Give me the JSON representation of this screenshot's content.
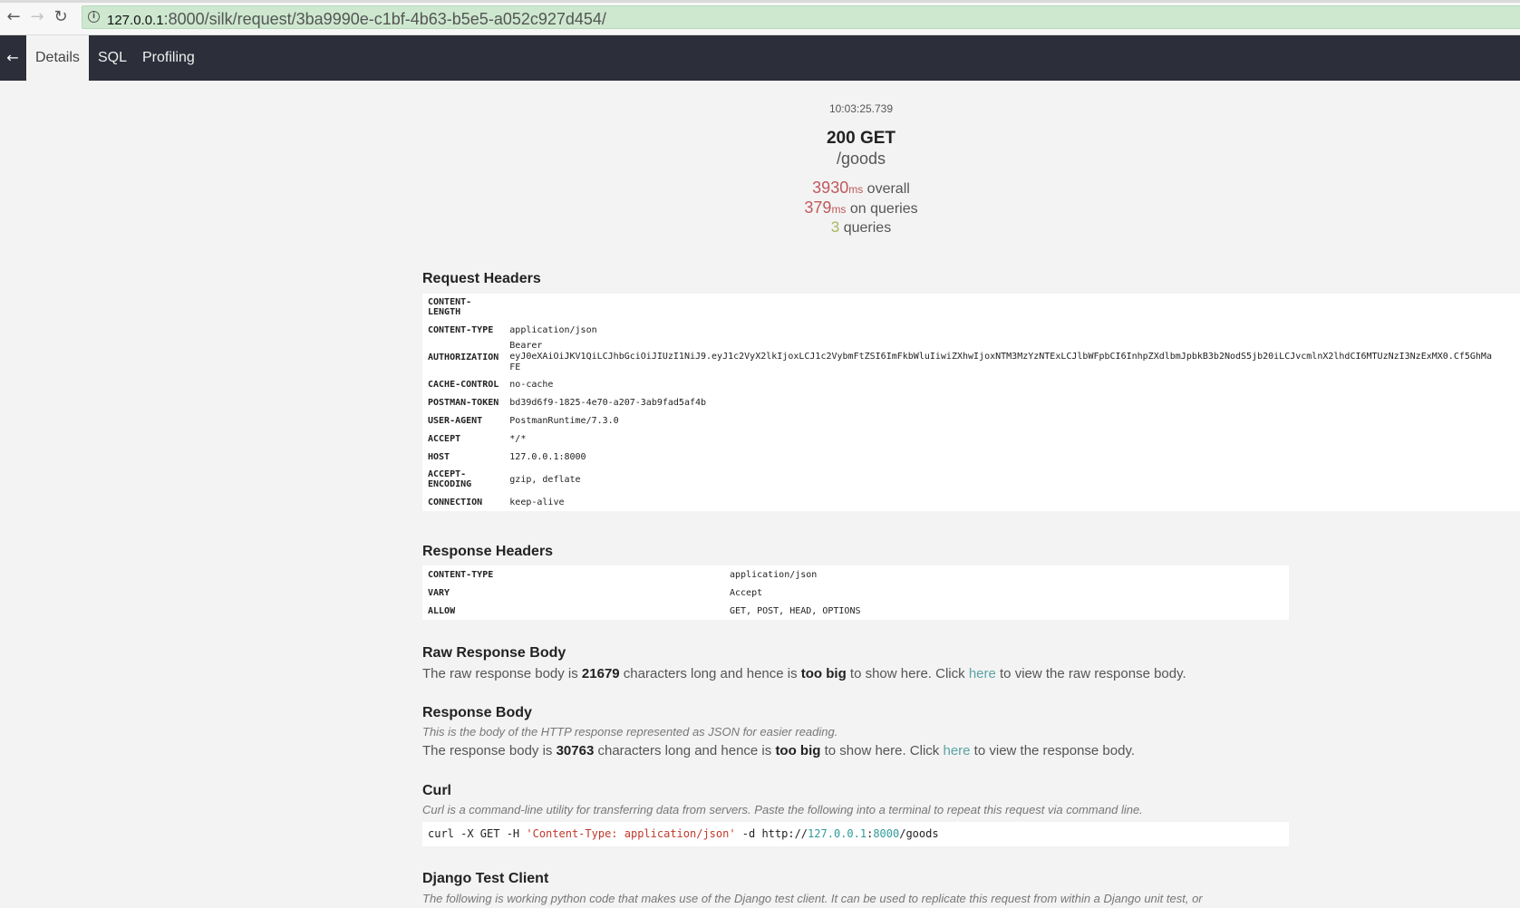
{
  "browser": {
    "url_host": "127.0.0.1",
    "url_rest": ":8000/silk/request/3ba9990e-c1bf-4b63-b5e5-a052c927d454/"
  },
  "nav": {
    "tabs": [
      {
        "label": "Details",
        "active": true
      },
      {
        "label": "SQL",
        "active": false
      },
      {
        "label": "Profiling",
        "active": false
      }
    ]
  },
  "summary": {
    "timestamp": "10:03:25.739",
    "status_line": "200 GET",
    "path": "/goods",
    "overall_value": "3930",
    "overall_unit": "ms",
    "overall_label": "overall",
    "queries_time_value": "379",
    "queries_time_unit": "ms",
    "queries_time_label": "on queries",
    "query_count": "3",
    "query_count_label": "queries"
  },
  "request_headers": {
    "title": "Request Headers",
    "rows": [
      {
        "key": "CONTENT-\nLENGTH",
        "value": ""
      },
      {
        "key": "CONTENT-TYPE",
        "value": "application/json"
      },
      {
        "key": "AUTHORIZATION",
        "value": "Bearer\neyJ0eXAiOiJKV1QiLCJhbGciOiJIUzI1NiJ9.eyJ1c2VyX2lkIjoxLCJ1c2VybmFtZSI6ImFkbWluIiwiZXhwIjoxNTM3MzYzNTExLCJlbWFpbCI6InhpZXdlbmJpbkB3b2NodS5jb20iLCJvcmlnX2lhdCI6MTUzNzI3NzExMX0.Cf5GhMa\nFE"
      },
      {
        "key": "CACHE-CONTROL",
        "value": "no-cache"
      },
      {
        "key": "POSTMAN-TOKEN",
        "value": "bd39d6f9-1825-4e70-a207-3ab9fad5af4b"
      },
      {
        "key": "USER-AGENT",
        "value": "PostmanRuntime/7.3.0"
      },
      {
        "key": "ACCEPT",
        "value": "*/*"
      },
      {
        "key": "HOST",
        "value": "127.0.0.1:8000"
      },
      {
        "key": "ACCEPT-\nENCODING",
        "value": "gzip, deflate"
      },
      {
        "key": "CONNECTION",
        "value": "keep-alive"
      }
    ]
  },
  "response_headers": {
    "title": "Response Headers",
    "rows": [
      {
        "key": "CONTENT-TYPE",
        "value": "application/json"
      },
      {
        "key": "VARY",
        "value": "Accept"
      },
      {
        "key": "ALLOW",
        "value": "GET, POST, HEAD, OPTIONS"
      }
    ]
  },
  "raw_body": {
    "title": "Raw Response Body",
    "text_1": "The raw response body is ",
    "length": "21679",
    "text_2": " characters long and hence is ",
    "too_big": "too big",
    "text_3": " to show here. Click ",
    "link": "here",
    "text_4": " to view the raw response body."
  },
  "body": {
    "title": "Response Body",
    "desc": "This is the body of the HTTP response represented as JSON for easier reading.",
    "text_1": "The response body is ",
    "length": "30763",
    "text_2": " characters long and hence is ",
    "too_big": "too big",
    "text_3": " to show here. Click ",
    "link": "here",
    "text_4": " to view the response body."
  },
  "curl": {
    "title": "Curl",
    "desc": "Curl is a command-line utility for transferring data from servers. Paste the following into a terminal to repeat this request via command line.",
    "cmd_1": "curl -X GET -H ",
    "cmd_str": "'Content-Type: application/json'",
    "cmd_2": " -d  http://",
    "cmd_host": "127.0.0.1",
    "cmd_colon": ":",
    "cmd_port": "8000",
    "cmd_path": "/goods"
  },
  "django": {
    "title": "Django Test Client",
    "desc": "The following is working python code that makes use of the Django test client. It can be used to replicate this request from within a Django unit test, or"
  }
}
